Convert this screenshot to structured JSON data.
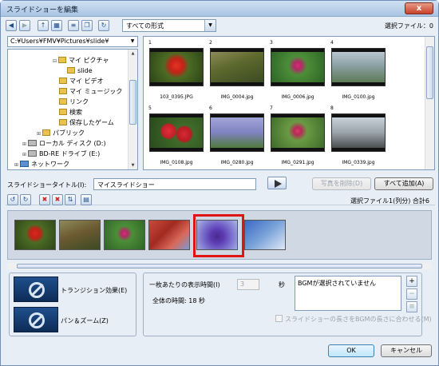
{
  "window": {
    "title": "スライドショーを編集",
    "close": "x"
  },
  "toolbar": {
    "icons": [
      "back-icon",
      "forward-icon",
      "folder-up-icon",
      "view-icon",
      "details-icon",
      "copy-icon",
      "refresh-icon"
    ],
    "filter_value": "すべての形式",
    "selected_count": "選択ファイル：0"
  },
  "tree": {
    "path": "C:¥Users¥FMV¥Pictures¥slide¥",
    "items": [
      {
        "label": "マイ ピクチャ"
      },
      {
        "label": "slide"
      },
      {
        "label": "マイ ビデオ"
      },
      {
        "label": "マイ ミュージック"
      },
      {
        "label": "リンク"
      },
      {
        "label": "検索"
      },
      {
        "label": "保存したゲーム"
      },
      {
        "label": "パブリック"
      },
      {
        "label": "ローカル ディスク (D:)"
      },
      {
        "label": "BD-RE ドライブ (E:)"
      },
      {
        "label": "ネットワーク"
      }
    ]
  },
  "grid": {
    "items": [
      {
        "num": "1",
        "caption": "103_0395.JPG",
        "color": "#d8281a"
      },
      {
        "num": "2",
        "caption": "IMG_0004.jpg",
        "color": "#6a7a3a"
      },
      {
        "num": "3",
        "caption": "IMG_0006.jpg",
        "color": "#3f8a3a"
      },
      {
        "num": "4",
        "caption": "IMG_0100.jpg",
        "color": "#7d9a9e"
      },
      {
        "num": "5",
        "caption": "IMG_0108.jpg",
        "color": "#c61f2a"
      },
      {
        "num": "6",
        "caption": "IMG_0280.jpg",
        "color": "#8c8ec8"
      },
      {
        "num": "7",
        "caption": "IMG_0291.jpg",
        "color": "#5d8f3b"
      },
      {
        "num": "8",
        "caption": "IMG_0339.jpg",
        "color": "#9aa2ab"
      }
    ]
  },
  "slideshow": {
    "title_label": "スライドショータイトル(I):",
    "title_value": "マイスライドショー",
    "remove_button": "写真を削除(D)",
    "add_all_button": "すべて追加(A)",
    "selected_info": "選択ファイル1(列分) 合計6"
  },
  "strip": {
    "thumbs": [
      {
        "color": "#c42a1c"
      },
      {
        "color": "#7b6a3a"
      },
      {
        "color": "#4f8a2e"
      },
      {
        "color": "#b8412e"
      },
      {
        "color": "#5a3a9e"
      },
      {
        "color": "#7aa3d8"
      }
    ]
  },
  "options": {
    "transition_label": "トランジション効果(E)",
    "panzoom_label": "パン＆ズーム(Z)",
    "per_slide_label": "一枚あたりの表示時間(I)",
    "per_slide_value": "3",
    "per_slide_unit": "秒",
    "total_time": "全体の時間: 18 秒",
    "bgm_text": "BGMが選択されていません",
    "fit_label": "スライドショーの長さをBGMの長さに合わせる(M)"
  },
  "footer": {
    "ok": "OK",
    "cancel": "キャンセル"
  }
}
